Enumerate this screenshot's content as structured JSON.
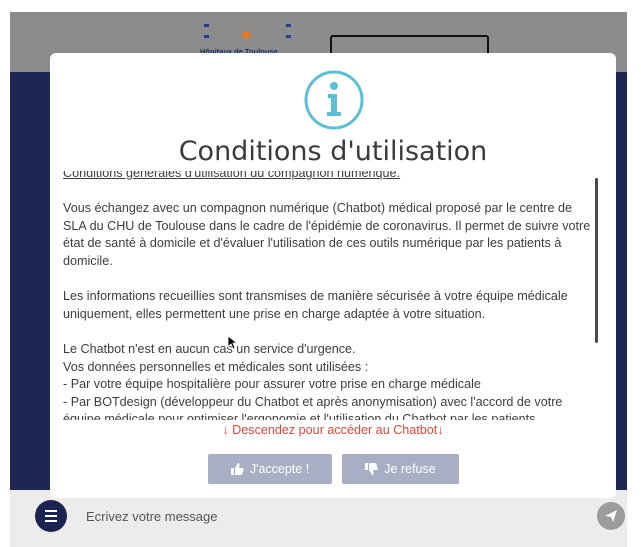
{
  "header": {
    "logo_text": "Hôpitaux de Toulouse"
  },
  "modal": {
    "icon": "info-icon",
    "title": "Conditions d'utilisation",
    "terms_heading": "Conditions générales d'utilisation du compagnon numérique.",
    "paragraphs": [
      "Vous échangez avec un compagnon numérique (Chatbot) médical proposé par le centre de SLA du CHU de Toulouse dans le cadre de l'épidémie de coronavirus. Il permet de suivre votre état de santé à domicile et d'évaluer l'utilisation de ces outils numérique par les patients à domicile.",
      "Les informations recueillies sont transmises de manière sécurisée à votre équipe médicale uniquement, elles permettent une prise en charge adaptée à votre situation."
    ],
    "lines": [
      "Le Chatbot n'est en aucun cas un service d'urgence.",
      "Vos données personnelles et médicales sont utilisées :",
      "- Par votre équipe hospitalière pour assurer votre prise en charge médicale",
      "- Par BOTdesign (développeur du Chatbot et après anonymisation) avec l'accord de votre équipe médicale pour optimiser l'ergonomie et l'utilisation du Chatbot par les patients."
    ],
    "scroll_hint": "Descendez pour accéder au Chatbot",
    "accept_label": "J'accepte !",
    "refuse_label": "Je refuse",
    "colors": {
      "accent": "#5bbfd6",
      "hint": "#d9483b",
      "button": "#a8afc4"
    }
  },
  "chat": {
    "placeholder": "Ecrivez votre message"
  }
}
